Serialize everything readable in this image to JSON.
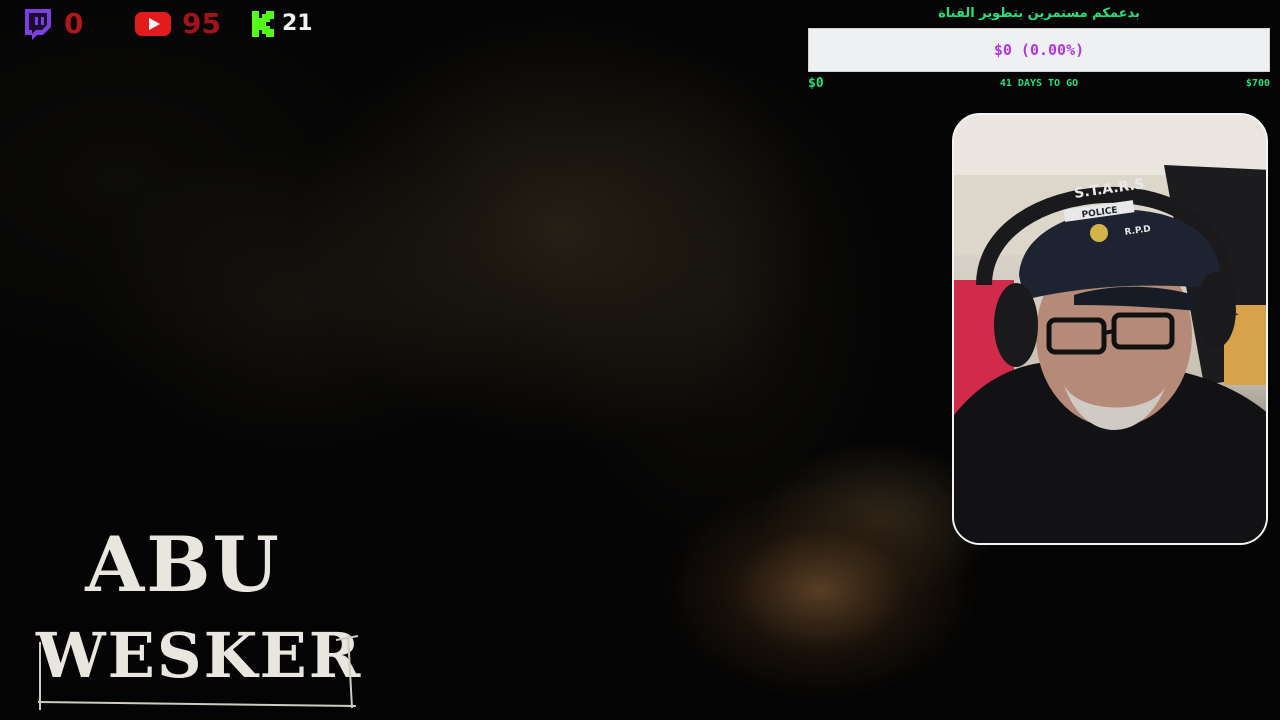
{
  "social": {
    "twitch": {
      "icon": "twitch-icon",
      "count": "0",
      "color": "#9146ff"
    },
    "youtube": {
      "icon": "youtube-icon",
      "count": "95",
      "color": "#ff0000"
    },
    "kick": {
      "icon": "kick-icon",
      "count": "21",
      "color": "#53fc18"
    }
  },
  "goal": {
    "title": "بدعمكم مستمرين بتطوير القناة",
    "bar_text": "$0 (0.00%)",
    "progress_fraction": 0.0,
    "min_label": "$0",
    "days_label": "41 DAYS TO GO",
    "max_label": "$700",
    "accent_color": "#27e07a",
    "bar_text_color": "#b236e0"
  },
  "webcam": {
    "cap_text": "S.T.A.R.S",
    "cap_subtext": "POLICE",
    "cap_subtext2": "R.P.D"
  },
  "logo": {
    "line1": "ABU",
    "line2": "WESKER"
  }
}
